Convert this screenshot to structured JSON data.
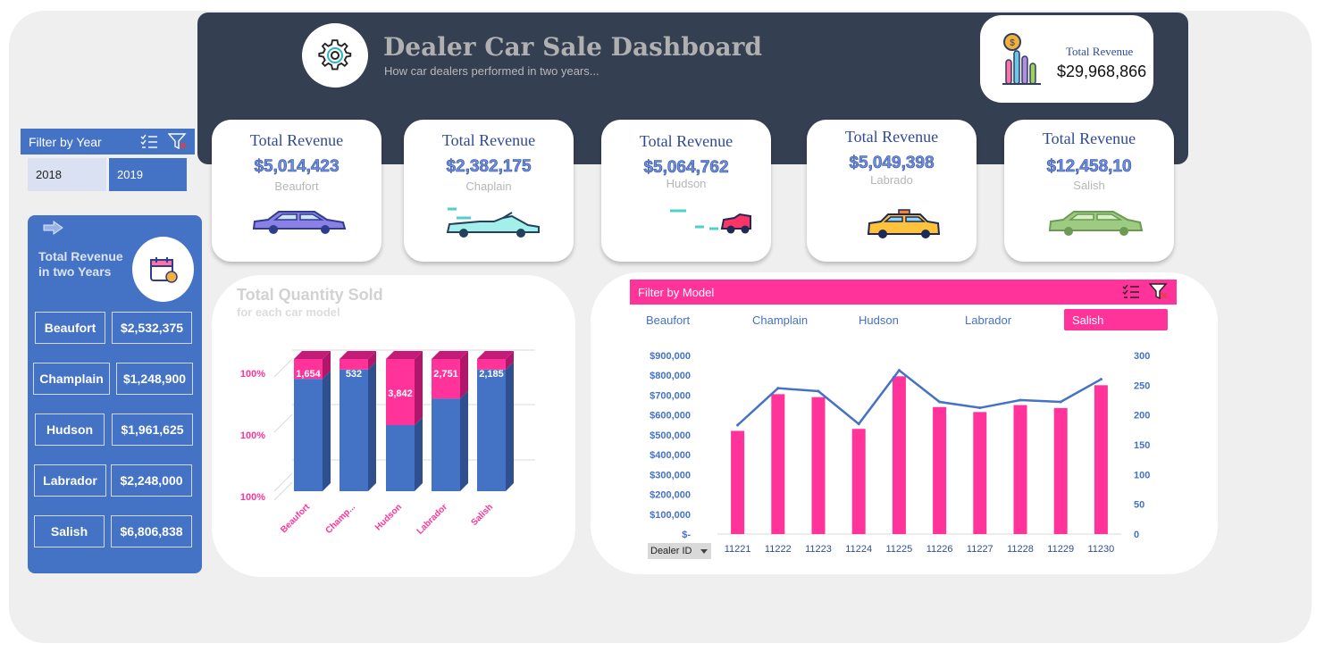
{
  "header": {
    "title": "Dealer Car Sale Dashboard",
    "subtitle": "How car dealers performed in two years...",
    "total_label": "Total Revenue",
    "total_value": "$29,968,866"
  },
  "cards": [
    {
      "label": "Total Revenue",
      "value": "$5,014,423",
      "name": "Beaufort"
    },
    {
      "label": "Total Revenue",
      "value": "$2,382,175",
      "name": "Chaplain"
    },
    {
      "label": "Total Revenue",
      "value": "$5,064,762",
      "name": "Hudson"
    },
    {
      "label": "Total Revenue",
      "value": "$5,049,398",
      "name": "Labrado"
    },
    {
      "label": "Total Revenue",
      "value": "$12,458,10",
      "name": "Salish"
    }
  ],
  "filter_year": {
    "title": "Filter by Year",
    "options": [
      "2018",
      "2019"
    ],
    "selected": "2019"
  },
  "side": {
    "title": "Total Revenue in two Years",
    "rows": [
      {
        "name": "Beaufort",
        "value": "$2,532,375"
      },
      {
        "name": "Champlain",
        "value": "$1,248,900"
      },
      {
        "name": "Hudson",
        "value": "$1,961,625"
      },
      {
        "name": "Labrador",
        "value": "$2,248,000"
      },
      {
        "name": "Salish",
        "value": "$6,806,838"
      }
    ]
  },
  "quantity": {
    "title": "Total Quantity Sold",
    "subtitle": "for each car model"
  },
  "filter_model": {
    "title": "Filter by Model",
    "options": [
      "Beaufort",
      "Champlain",
      "Hudson",
      "Labrador",
      "Salish"
    ],
    "selected": "Salish"
  },
  "dealer_dropdown": "Dealer ID",
  "colors": {
    "blue": "#4472c4",
    "pink": "#ff3399",
    "navy": "#353f52",
    "light_blue": "#d9e1f2"
  },
  "chart_data": [
    {
      "type": "bar",
      "stacked": "100%",
      "title": "Total Quantity Sold",
      "subtitle": "for each car model",
      "categories": [
        "Beaufort",
        "Champ...",
        "Hudson",
        "Labrador",
        "Salish"
      ],
      "y_tick_labels": [
        "100%",
        "100%",
        "100%"
      ],
      "series": [
        {
          "color": "#4472c4",
          "share": [
            0.85,
            0.92,
            0.5,
            0.7,
            0.92
          ]
        },
        {
          "color": "#ff3399",
          "share": [
            0.15,
            0.08,
            0.5,
            0.3,
            0.08
          ],
          "values": [
            1654,
            532,
            3842,
            2751,
            2185
          ]
        }
      ],
      "data_labels": [
        "1,654",
        "532",
        "3,842",
        "2,751",
        "2,185"
      ]
    },
    {
      "type": "bar",
      "combo": "bar+line",
      "xlabel": "Dealer ID",
      "categories": [
        "11221",
        "11222",
        "11223",
        "11224",
        "11225",
        "11226",
        "11227",
        "11228",
        "11229",
        "11230"
      ],
      "y_left_ticks": [
        "$-",
        "$100,000",
        "$200,000",
        "$300,000",
        "$400,000",
        "$500,000",
        "$600,000",
        "$700,000",
        "$800,000",
        "$900,000"
      ],
      "y_left_lim": [
        0,
        900000
      ],
      "y_right_ticks": [
        "0",
        "50",
        "100",
        "150",
        "200",
        "250",
        "300"
      ],
      "y_right_lim": [
        0,
        300
      ],
      "series": [
        {
          "type": "bar",
          "axis": "left",
          "color": "#ff3399",
          "values": [
            520000,
            705000,
            690000,
            530000,
            795000,
            640000,
            615000,
            650000,
            635000,
            750000
          ]
        },
        {
          "type": "line",
          "axis": "right",
          "color": "#4472c4",
          "values": [
            183,
            245,
            240,
            185,
            275,
            222,
            212,
            225,
            222,
            260
          ]
        }
      ]
    }
  ]
}
